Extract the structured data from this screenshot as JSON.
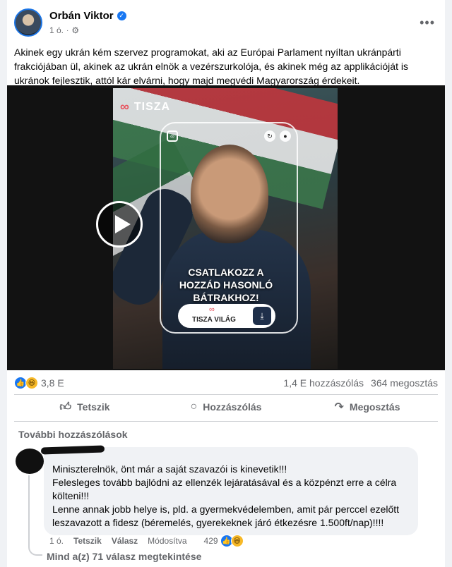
{
  "post": {
    "author": "Orbán Viktor",
    "verified_icon": "verified-badge-icon",
    "time": "1 ó.",
    "audience_icon": "gear-icon",
    "more_label": "•••",
    "text": "Akinek egy ukrán kém szervez programokat, aki az Európai Parlament nyíltan ukránpárti frakciójában ül, akinek az ukrán elnök a vezérszurkolója, és akinek még az applikációját is ukránok fejlesztik, attól kár elvárni, hogy majd megvédi Magyarország érdekeit."
  },
  "video": {
    "brand": "TISZA",
    "slogan_line1": "CSATLAKOZZ A",
    "slogan_line2": "HOZZÁD HASONLÓ",
    "slogan_line3": "BÁTRAKHOZ!",
    "cta_label": "TISZA VILÁG"
  },
  "stats": {
    "reactions": "3,8 E",
    "comments": "1,4 E hozzászólás",
    "shares": "364 megosztás"
  },
  "actions": {
    "like": "Tetszik",
    "comment": "Hozzászólás",
    "share": "Megosztás"
  },
  "comments_section": {
    "more_comments": "További hozzászólások",
    "comment": {
      "line1": "Miniszterelnök, önt már a saját szavazói is kinevetik!!!",
      "line2": "Felesleges tovább bajlódni az ellenzék lejáratásával és a közpénzt erre a célra költeni!!!",
      "line3": "Lenne annak jobb helye is, pld. a gyermekvédelemben, amit pár perccel ezelőtt leszavazott a fidesz (béremelés, gyerekeknek járó étkezésre 1.500ft/nap)!!!!",
      "time": "1 ó.",
      "like": "Tetszik",
      "reply": "Válasz",
      "edited": "Módosítva",
      "reaction_count": "429"
    },
    "view_replies": "Mind a(z) 71 válasz megtekintése"
  },
  "colors": {
    "accent": "#1877f2",
    "text_secondary": "#65676b",
    "bubble": "#f0f2f5"
  }
}
